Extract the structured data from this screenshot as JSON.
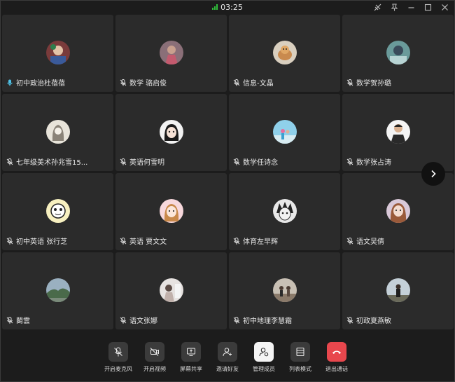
{
  "header": {
    "timer": "03:25"
  },
  "participants": [
    {
      "name": "初中政治杜蓓蓓",
      "speaking": true,
      "avatar": "a1"
    },
    {
      "name": "数学 骆启俊",
      "speaking": false,
      "avatar": "a2"
    },
    {
      "name": "信息-文晶",
      "speaking": false,
      "avatar": "a3"
    },
    {
      "name": "数学贺孙璐",
      "speaking": false,
      "avatar": "a4"
    },
    {
      "name": "七年级美术孙兆雪15...",
      "speaking": false,
      "avatar": "a5"
    },
    {
      "name": "英语何雪明",
      "speaking": false,
      "avatar": "a6"
    },
    {
      "name": "数学任诗念",
      "speaking": false,
      "avatar": "a7"
    },
    {
      "name": "数学张占涛",
      "speaking": false,
      "avatar": "a8"
    },
    {
      "name": "初中英语 张行芝",
      "speaking": false,
      "avatar": "a9"
    },
    {
      "name": "英语 贾文文",
      "speaking": false,
      "avatar": "a10"
    },
    {
      "name": "体育左早辉",
      "speaking": false,
      "avatar": "a11"
    },
    {
      "name": "语文吴倩",
      "speaking": false,
      "avatar": "a12"
    },
    {
      "name": "鬭雲",
      "speaking": false,
      "avatar": "a13"
    },
    {
      "name": "语文张娜",
      "speaking": false,
      "avatar": "a14"
    },
    {
      "name": "初中地理李慧霜",
      "speaking": false,
      "avatar": "a15"
    },
    {
      "name": "初政夏燕敏",
      "speaking": false,
      "avatar": "a16"
    }
  ],
  "toolbar": {
    "mic_label": "开启麦克风",
    "video_label": "开启视频",
    "share_label": "屏幕共享",
    "invite_label": "邀请好友",
    "manage_label": "管理成员",
    "list_label": "列表模式",
    "exit_label": "退出通话"
  },
  "colors": {
    "background": "#1c1c1c",
    "tile": "#2b2b2b",
    "speaking_mic": "#4fc3e8",
    "hangup": "#e8474d",
    "signal": "#2fbf3a"
  }
}
